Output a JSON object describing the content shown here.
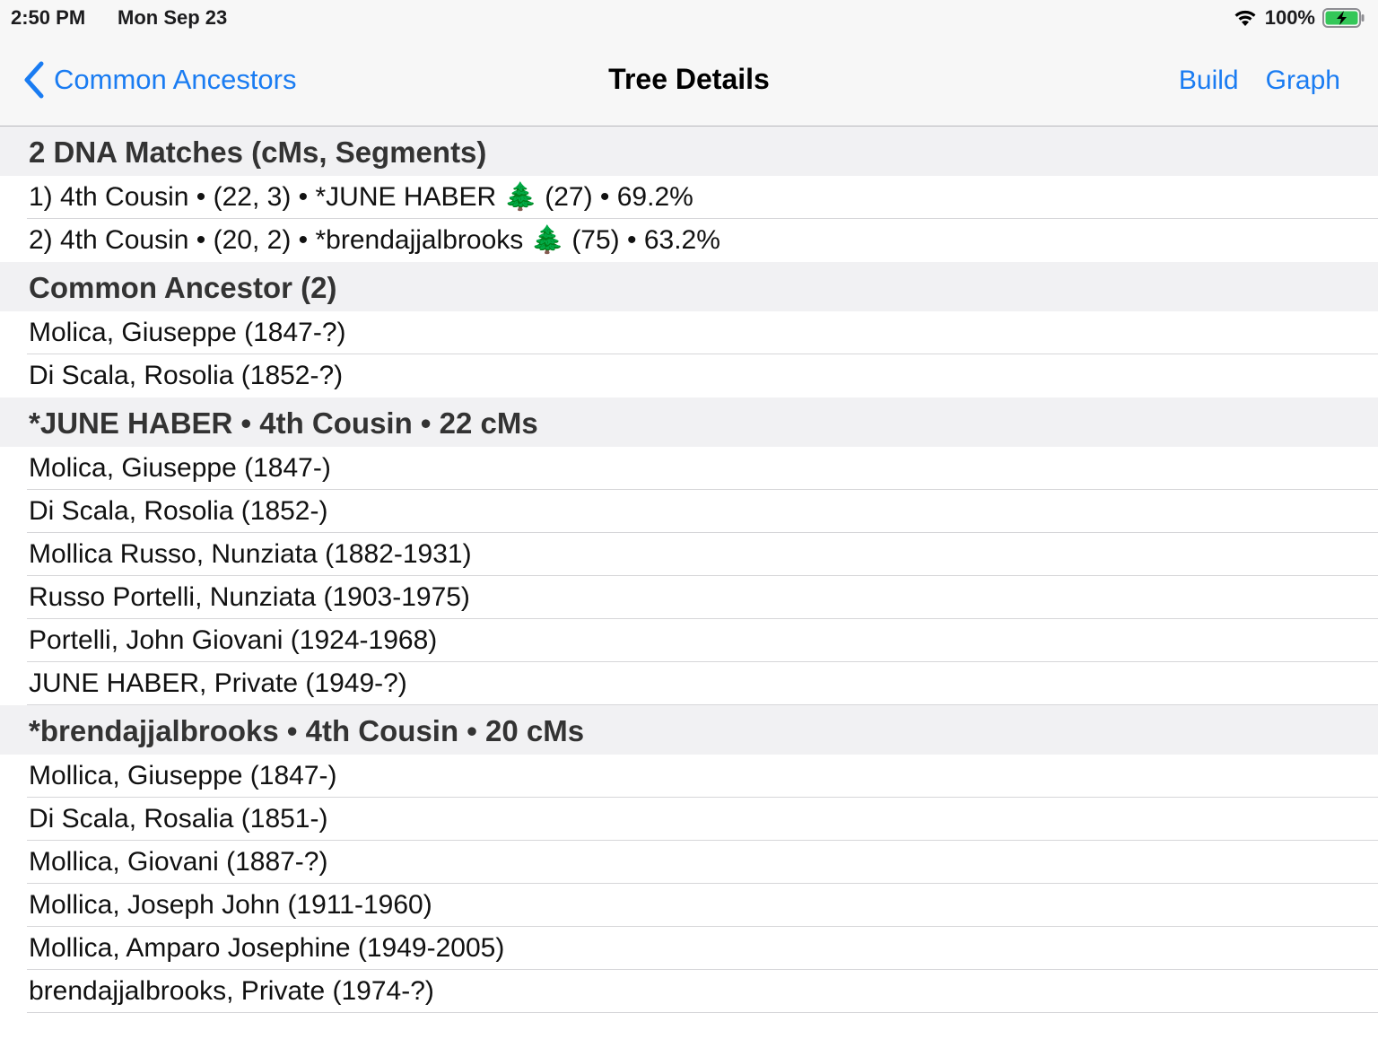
{
  "status_bar": {
    "time": "2:50 PM",
    "date": "Mon Sep 23",
    "battery_percent": "100%",
    "battery_level": 1.0,
    "battery_color": "#34c759",
    "wifi_icon": "wifi-icon",
    "battery_icon": "battery-charging-icon"
  },
  "nav": {
    "back_label": "Common Ancestors",
    "back_icon": "chevron-left-icon",
    "title": "Tree Details",
    "actions": [
      "Build",
      "Graph"
    ],
    "accent_color": "#1a7cf2"
  },
  "sections": [
    {
      "header": "2 DNA Matches (cMs, Segments)",
      "rows": [
        "1) 4th Cousin • (22, 3) • *JUNE HABER 🌲 (27) • 69.2%",
        "2) 4th Cousin • (20, 2) • *brendajjalbrooks 🌲 (75) • 63.2%"
      ]
    },
    {
      "header": "Common Ancestor (2)",
      "rows": [
        "Molica, Giuseppe (1847-?)",
        "Di Scala, Rosolia (1852-?)"
      ]
    },
    {
      "header": "*JUNE HABER • 4th Cousin • 22 cMs",
      "rows": [
        "Molica, Giuseppe (1847-)",
        "Di Scala, Rosolia (1852-)",
        "Mollica Russo, Nunziata (1882-1931)",
        "Russo Portelli, Nunziata (1903-1975)",
        "Portelli, John  Giovani (1924-1968)",
        "JUNE HABER, Private (1949-?)"
      ]
    },
    {
      "header": "*brendajjalbrooks • 4th Cousin • 20 cMs",
      "rows": [
        "Mollica, Giuseppe (1847-)",
        "Di Scala, Rosalia (1851-)",
        "Mollica, Giovani (1887-?)",
        "Mollica, Joseph John (1911-1960)",
        "Mollica, Amparo Josephine (1949-2005)",
        "brendajjalbrooks, Private (1974-?)"
      ]
    }
  ]
}
